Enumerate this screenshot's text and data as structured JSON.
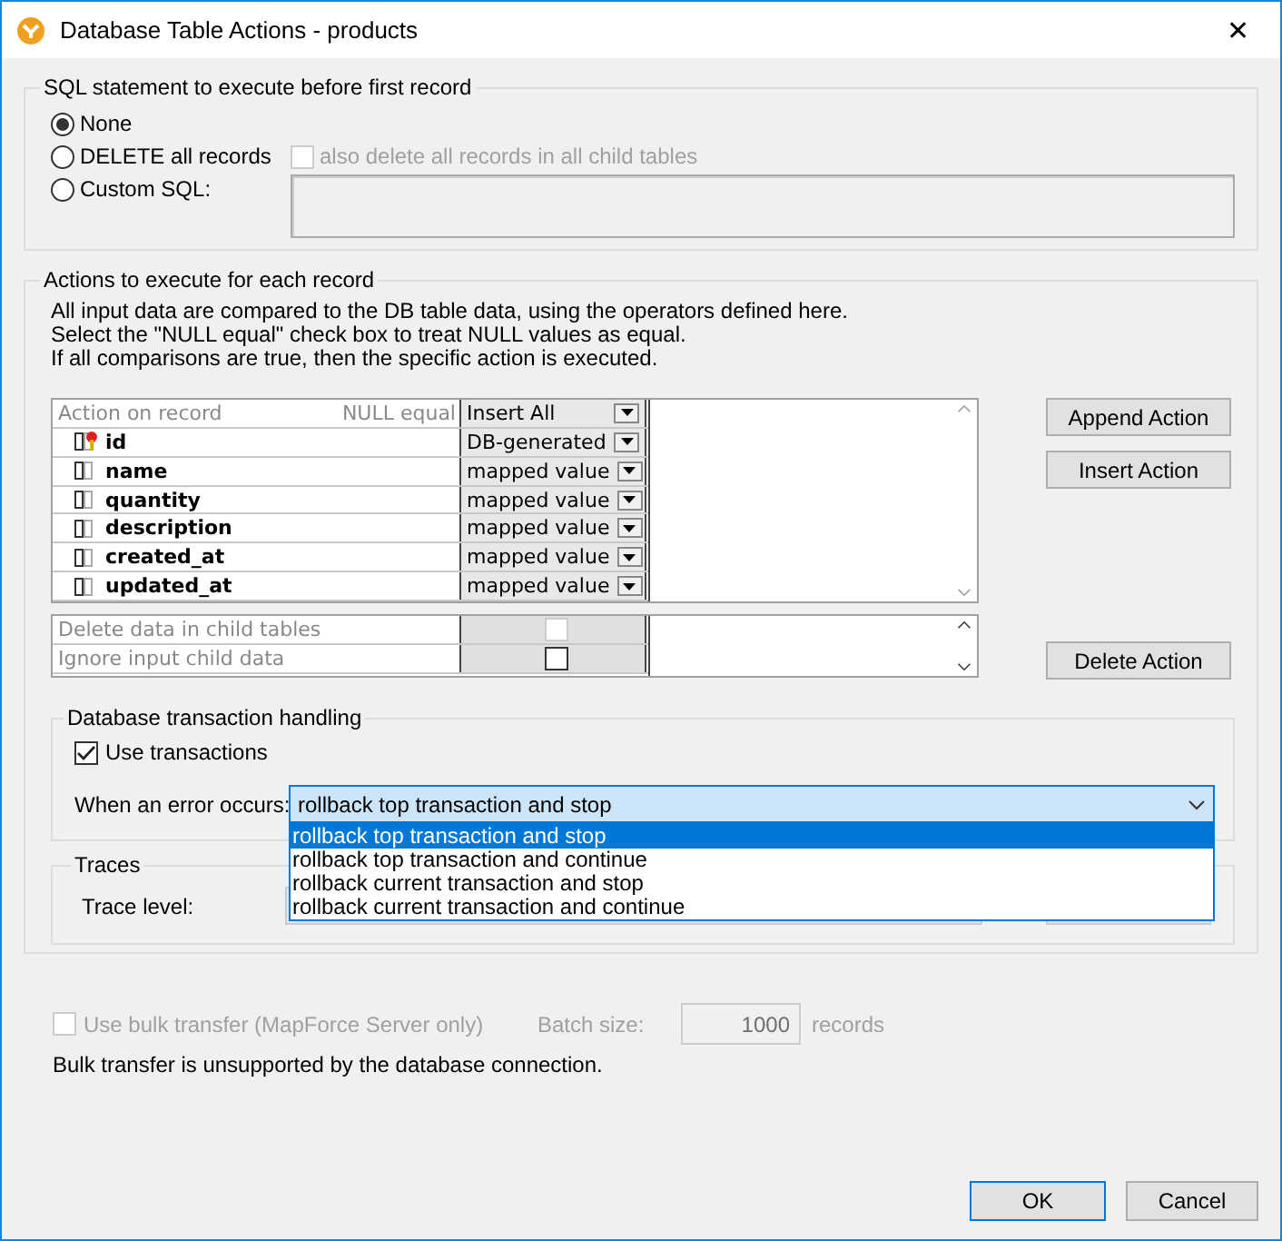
{
  "window": {
    "title": "Database Table Actions - products",
    "close": "✕"
  },
  "sql_group": {
    "legend": "SQL statement to execute before first record",
    "options": [
      {
        "label": "None",
        "selected": true
      },
      {
        "label": "DELETE all records",
        "selected": false
      },
      {
        "label": "Custom SQL:",
        "selected": false
      }
    ],
    "child_delete": {
      "label": "also delete all records in all child tables",
      "checked": false,
      "disabled": true
    },
    "custom_sql": {
      "disabled": true
    }
  },
  "actions_group": {
    "legend": "Actions to execute for each record",
    "description": [
      "All input data are compared to the DB table data, using the operators defined here.",
      "Select the \"NULL equal\" check box to treat NULL values as equal.",
      "If all comparisons are true, then the specific action is executed."
    ],
    "table": {
      "header": {
        "action": "Action on record",
        "null_equal": "NULL equal",
        "value": "Insert All"
      },
      "rows": [
        {
          "name": "id",
          "key": true,
          "value": "DB-generated"
        },
        {
          "name": "name",
          "key": false,
          "value": "mapped value"
        },
        {
          "name": "quantity",
          "key": false,
          "value": "mapped value"
        },
        {
          "name": "description",
          "key": false,
          "value": "mapped value"
        },
        {
          "name": "created_at",
          "key": false,
          "value": "mapped value"
        },
        {
          "name": "updated_at",
          "key": false,
          "value": "mapped value"
        }
      ]
    },
    "options_table": [
      {
        "label": "Delete data in child tables",
        "checked": false,
        "disabled": true
      },
      {
        "label": "Ignore input child data",
        "checked": false,
        "disabled": false
      }
    ],
    "buttons": [
      "Append Action",
      "Insert Action",
      "Delete Action"
    ],
    "transactions": {
      "legend": "Database transaction handling",
      "use": {
        "label": "Use transactions",
        "checked": true
      },
      "error_label": "When an error occurs:",
      "error_value": "rollback top transaction and stop",
      "options": [
        {
          "label": "rollback top transaction and stop",
          "selected": true
        },
        {
          "label": "rollback top transaction and continue",
          "selected": false
        },
        {
          "label": "rollback current transaction and stop",
          "selected": false
        },
        {
          "label": "rollback current transaction and continue",
          "selected": false
        }
      ]
    },
    "traces": {
      "legend": "Traces",
      "label": "Trace level:"
    }
  },
  "bulk": {
    "label": "Use bulk transfer (MapForce Server only)",
    "checked": false,
    "disabled": true,
    "batch_label": "Batch size:",
    "batch_value": "1000",
    "unit": "records",
    "note": "Bulk transfer is unsupported by the database connection."
  },
  "footer_buttons": [
    "OK",
    "Cancel"
  ]
}
